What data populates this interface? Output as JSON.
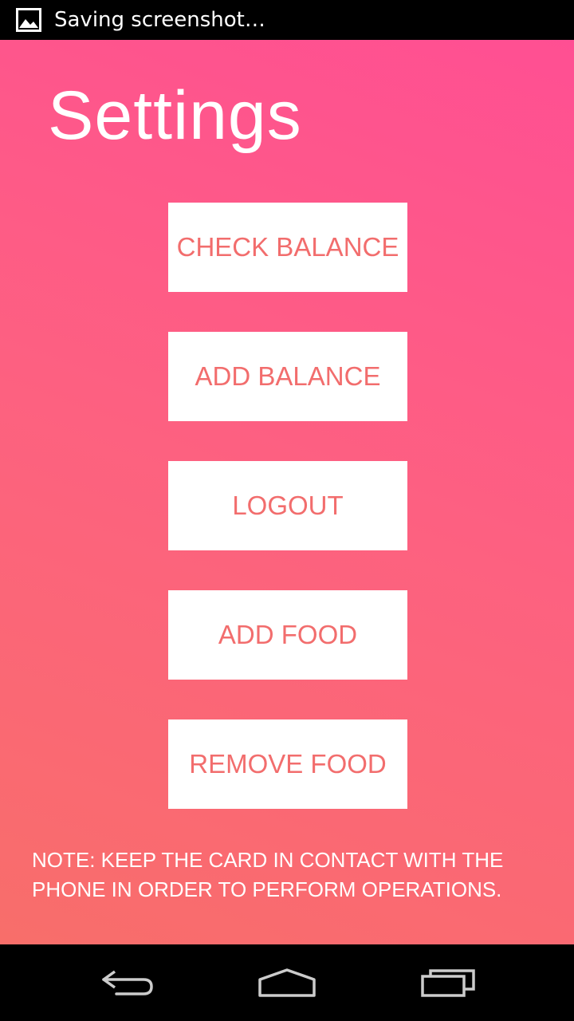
{
  "status_bar": {
    "notification_icon": "image-icon",
    "text": "Saving screenshot…"
  },
  "page": {
    "title": "Settings",
    "background_gradient": [
      "#ff4f93",
      "#f86e6a"
    ],
    "button_text_color": "#f26d6d"
  },
  "buttons": [
    {
      "label": "CHECK BALANCE"
    },
    {
      "label": "ADD BALANCE"
    },
    {
      "label": "LOGOUT"
    },
    {
      "label": "ADD FOOD"
    },
    {
      "label": "REMOVE FOOD"
    }
  ],
  "note": "NOTE: KEEP THE CARD IN CONTACT WITH THE PHONE IN ORDER TO PERFORM OPERATIONS.",
  "nav_bar": {
    "back_icon": "back-icon",
    "home_icon": "home-icon",
    "recents_icon": "recents-icon"
  }
}
